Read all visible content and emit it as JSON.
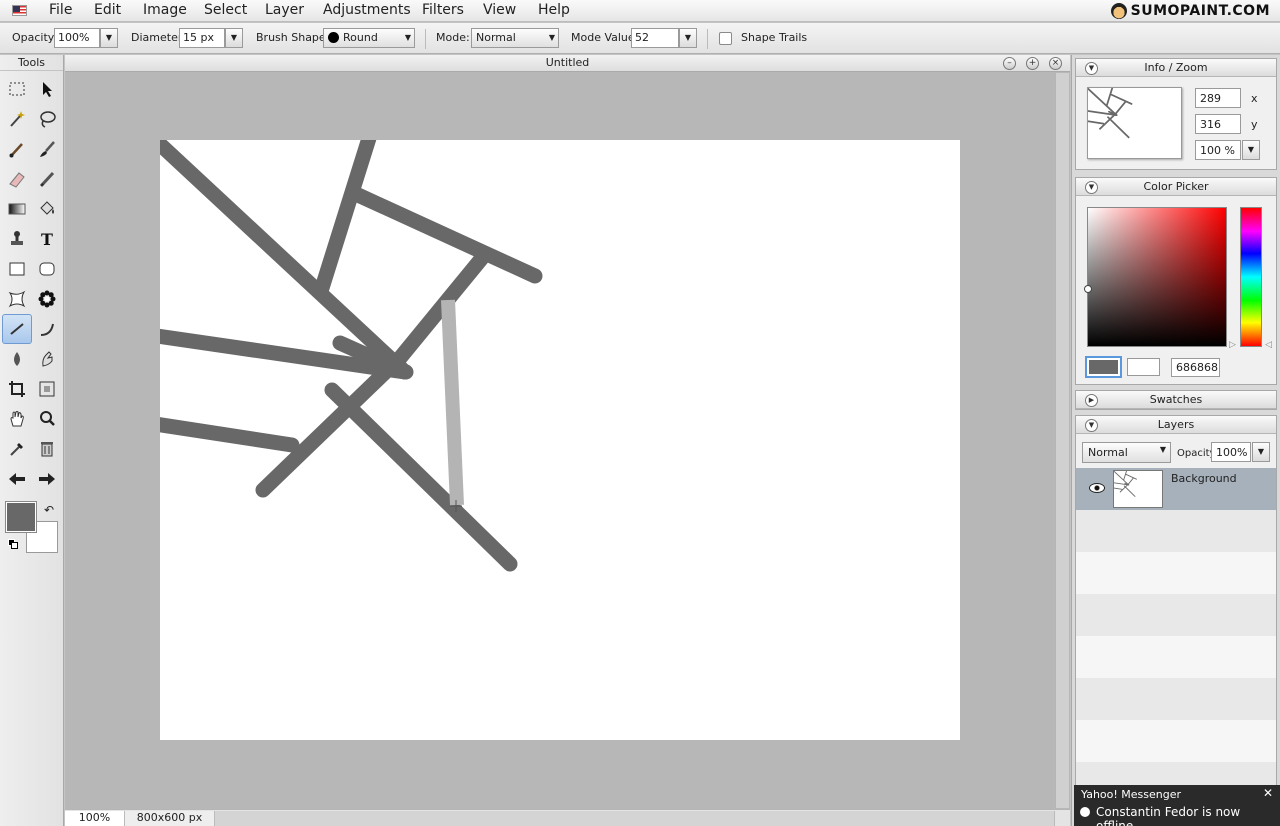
{
  "app": {
    "logo": "SUMOPAINT.COM"
  },
  "menu": {
    "items": [
      "File",
      "Edit",
      "Image",
      "Select",
      "Layer",
      "Adjustments",
      "Filters",
      "View",
      "Help"
    ]
  },
  "options": {
    "opacity_label": "Opacity:",
    "opacity_value": "100%",
    "diameter_label": "Diameter:",
    "diameter_value": "15 px",
    "brush_shape_label": "Brush Shape:",
    "brush_shape_value": "Round",
    "mode_label": "Mode:",
    "mode_value": "Normal",
    "mode_value_label": "Mode Value:",
    "mode_value_value": "52",
    "shape_trails_label": "Shape Trails"
  },
  "tools": {
    "title": "Tools",
    "fg_color": "#686868",
    "bg_color": "#ffffff",
    "items": [
      "rect-select",
      "move",
      "magic-wand",
      "lasso",
      "brush",
      "paint-brush",
      "eraser",
      "pencil",
      "gradient",
      "fill",
      "stamp",
      "text",
      "rectangle",
      "rounded-rect",
      "shape",
      "flower",
      "line",
      "curve",
      "drop",
      "smudge",
      "crop",
      "transform",
      "hand",
      "zoom",
      "eyedropper",
      "trash",
      "undo-arrow",
      "redo-arrow"
    ],
    "active": "line"
  },
  "document": {
    "title": "Untitled",
    "zoom": "100%",
    "size": "800x600 px",
    "stroke_color": "#686868",
    "preview_stroke_color": "#b4b4b4"
  },
  "info_zoom": {
    "title": "Info / Zoom",
    "x": "289",
    "x_label": "x",
    "y": "316",
    "y_label": "y",
    "zoom": "100 %"
  },
  "color_picker": {
    "title": "Color Picker",
    "hex": "686868",
    "hue_color": "#ff0000"
  },
  "swatches": {
    "title": "Swatches"
  },
  "layers": {
    "title": "Layers",
    "blend_mode": "Normal",
    "opacity_label": "Opacity:",
    "opacity_value": "100%",
    "items": [
      {
        "name": "Background"
      }
    ]
  },
  "messenger": {
    "title": "Yahoo! Messenger",
    "message": "Constantin Fedor is now offline"
  }
}
